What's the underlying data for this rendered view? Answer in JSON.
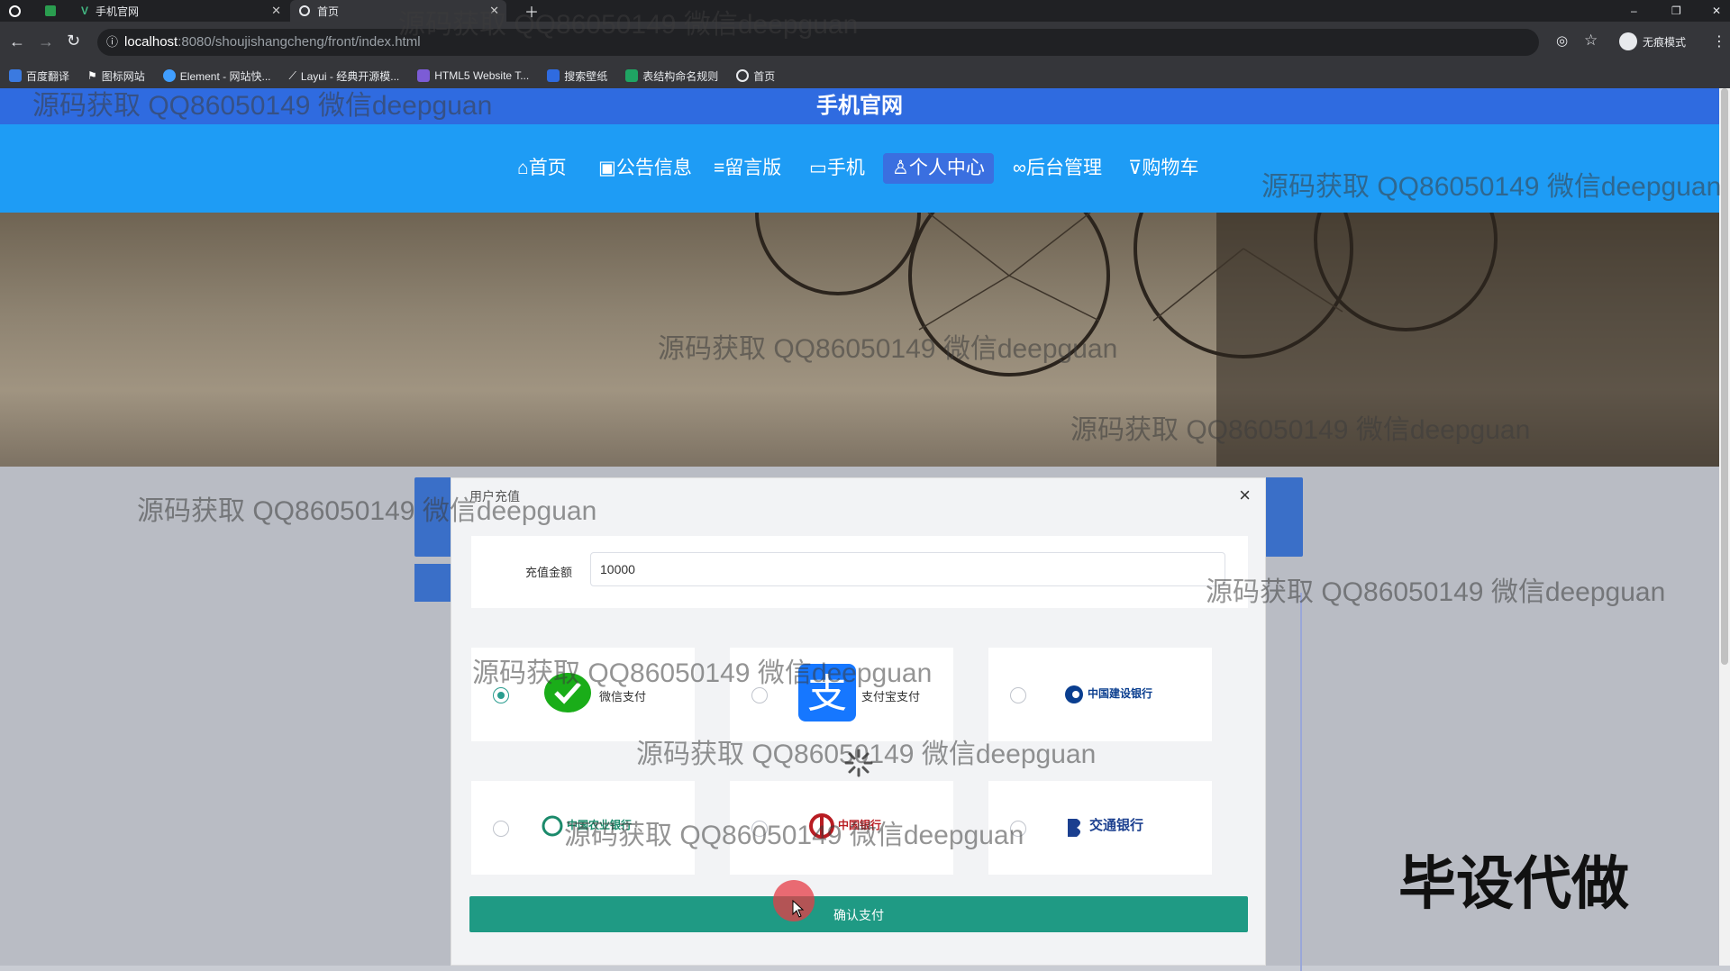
{
  "browser": {
    "tabs": [
      {
        "label": "手机官网",
        "active": false
      },
      {
        "label": "首页",
        "active": true
      }
    ],
    "url_host": "localhost",
    "url_path": ":8080/shoujishangcheng/front/index.html",
    "incognito_label": "无痕模式",
    "bookmarks": [
      "百度翻译",
      "图标网站",
      "Element - 网站快...",
      "Layui - 经典开源模...",
      "HTML5 Website T...",
      "搜索壁纸",
      "表结构命名规则",
      "首页"
    ]
  },
  "site": {
    "title": "手机官网",
    "nav": [
      {
        "label": "首页",
        "icon": "home-icon"
      },
      {
        "label": "公告信息",
        "icon": "notice-icon"
      },
      {
        "label": "留言版",
        "icon": "message-icon"
      },
      {
        "label": "手机",
        "icon": "phone-icon"
      },
      {
        "label": "个人中心",
        "icon": "user-icon",
        "active": true
      },
      {
        "label": "后台管理",
        "icon": "link-icon"
      },
      {
        "label": "购物车",
        "icon": "cart-icon"
      }
    ],
    "carousel_active_index": 2
  },
  "dialog": {
    "title": "用户充值",
    "amount_label": "充值金额",
    "amount_value": "10000",
    "options": [
      {
        "label": "微信支付",
        "selected": true
      },
      {
        "label": "支付宝支付",
        "selected": false
      },
      {
        "label": "中国建设银行",
        "selected": false
      },
      {
        "label": "中国农业银行",
        "selected": false
      },
      {
        "label": "中国银行",
        "selected": false
      },
      {
        "label": "交通银行",
        "selected": false
      }
    ],
    "confirm_label": "确认支付"
  },
  "watermark": "源码获取 QQ86050149 微信deepguan",
  "corner_text": "毕设代做",
  "colors": {
    "title_bar": "#2f6be0",
    "nav_bar": "#1e9cf5",
    "confirm": "#1f9a84",
    "radio_on": "#2a9d8f"
  }
}
